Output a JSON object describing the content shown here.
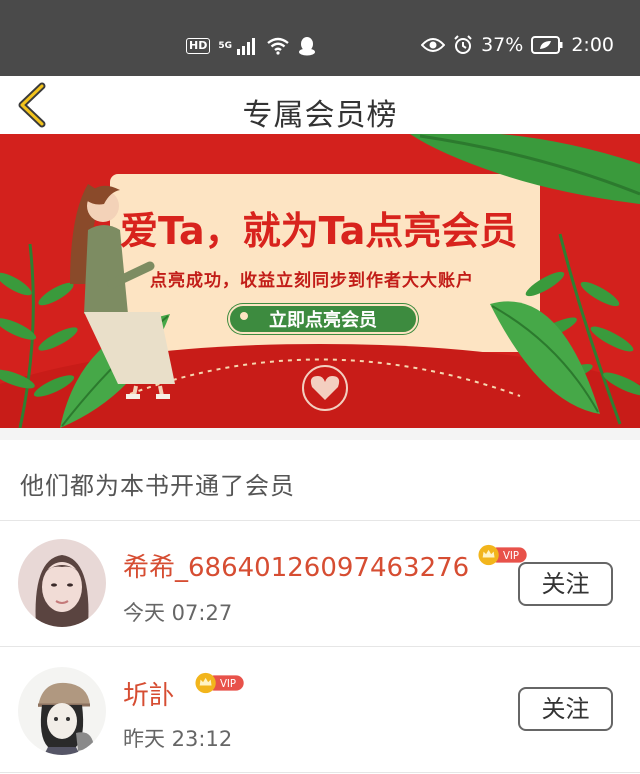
{
  "status_bar": {
    "hd": "HD",
    "network": "5G",
    "battery_percent": "37%",
    "time": "2:00"
  },
  "nav": {
    "title": "专属会员榜"
  },
  "banner": {
    "headline": "爱Ta，就为Ta点亮会员",
    "subtitle": "点亮成功，收益立刻同步到作者大大账户",
    "cta": "立即点亮会员",
    "colors": {
      "background": "#d3211d",
      "card": "#fde4c3",
      "cta": "#3d8b3f",
      "leaf": "#3a9a3c"
    }
  },
  "section": {
    "title": "他们都为本书开通了会员"
  },
  "members": [
    {
      "name": "希希_68640126097463276",
      "badge": "VIP",
      "time": "今天 07:27",
      "follow_label": "关注"
    },
    {
      "name": "圻訃",
      "badge": "VIP",
      "time": "昨天 23:12",
      "follow_label": "关注"
    }
  ],
  "colors": {
    "name": "#d64d32",
    "vip": "#e8524a",
    "crown": "#f2b51c"
  }
}
